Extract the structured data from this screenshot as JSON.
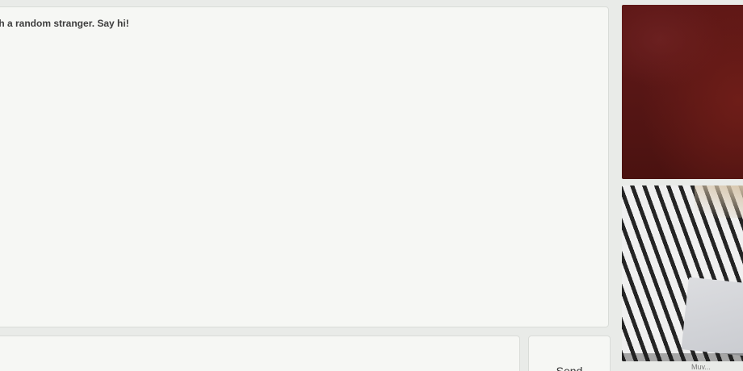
{
  "chat": {
    "status_message": "ith a random stranger. Say hi!"
  },
  "composer": {
    "input_value": "",
    "send_label": "Send"
  },
  "video": {
    "watermark": "Muv..."
  }
}
